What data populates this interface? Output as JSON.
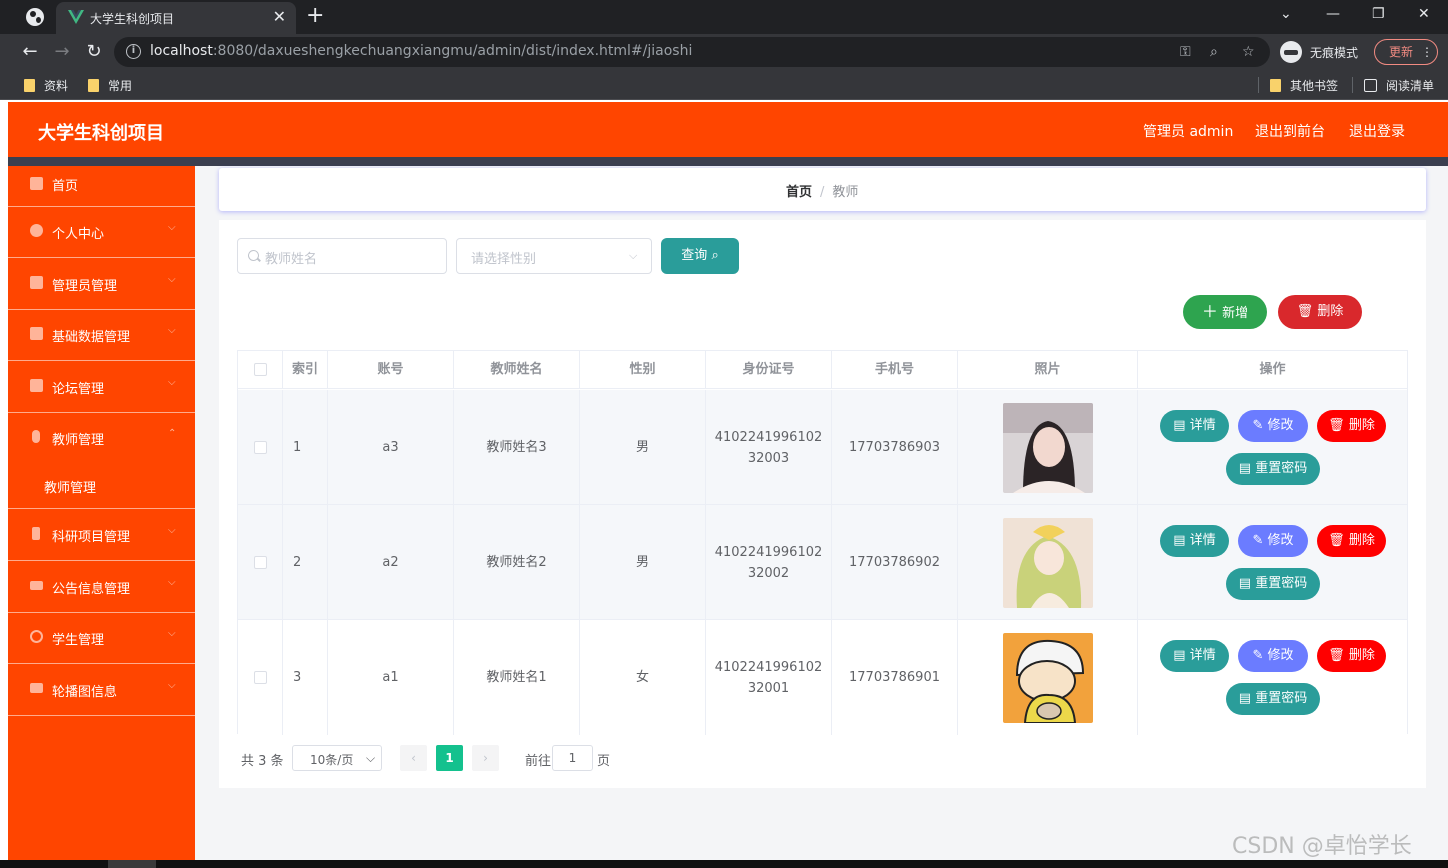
{
  "browser": {
    "tab_title": "大学生科创项目",
    "url_host": "localhost",
    "url_rest": ":8080/daxueshengkechuangxiangmu/admin/dist/index.html#/jiaoshi",
    "incognito_label": "无痕模式",
    "update_label": "更新",
    "bookmarks": [
      "资料",
      "常用"
    ],
    "other_bookmarks": "其他书签",
    "reading_list": "阅读清单"
  },
  "header": {
    "title": "大学生科创项目",
    "admin_label": "管理员 admin",
    "front_label": "退出到前台",
    "logout_label": "退出登录"
  },
  "sidebar": {
    "items": [
      {
        "label": "首页",
        "icon": "home-icon"
      },
      {
        "label": "个人中心",
        "icon": "user-icon"
      },
      {
        "label": "管理员管理",
        "icon": "briefcase-icon"
      },
      {
        "label": "基础数据管理",
        "icon": "chart-icon"
      },
      {
        "label": "论坛管理",
        "icon": "document-icon"
      },
      {
        "label": "教师管理",
        "icon": "microphone-icon",
        "expanded": true
      },
      {
        "label": "科研项目管理",
        "icon": "phone-icon"
      },
      {
        "label": "公告信息管理",
        "icon": "ticket-icon"
      },
      {
        "label": "学生管理",
        "icon": "target-icon"
      },
      {
        "label": "轮播图信息",
        "icon": "monitor-icon"
      }
    ],
    "sub_item": "教师管理"
  },
  "breadcrumb": {
    "home": "首页",
    "current": "教师"
  },
  "search": {
    "name_placeholder": "教师姓名",
    "gender_placeholder": "请选择性别",
    "query_label": "查询"
  },
  "actions": {
    "add_label": "新增",
    "delete_label": "删除"
  },
  "table": {
    "columns": [
      "索引",
      "账号",
      "教师姓名",
      "性别",
      "身份证号",
      "手机号",
      "照片",
      "操作"
    ],
    "rows": [
      {
        "index": "1",
        "account": "a3",
        "name": "教师姓名3",
        "gender": "男",
        "id_card": "410224199610232003",
        "phone": "17703786903"
      },
      {
        "index": "2",
        "account": "a2",
        "name": "教师姓名2",
        "gender": "男",
        "id_card": "410224199610232002",
        "phone": "17703786902"
      },
      {
        "index": "3",
        "account": "a1",
        "name": "教师姓名1",
        "gender": "女",
        "id_card": "410224199610232001",
        "phone": "17703786901"
      }
    ],
    "op_labels": {
      "detail": "详情",
      "edit": "修改",
      "delete": "删除",
      "reset": "重置密码"
    }
  },
  "pagination": {
    "total": "共 3 条",
    "page_size": "10条/页",
    "current_page": "1",
    "goto_label": "前往",
    "goto_value": "1",
    "page_unit": "页"
  },
  "watermark": "CSDN @卓怡学长",
  "colors": {
    "brand": "#ff4500",
    "teal": "#2a9d9a",
    "green": "#2ea44f",
    "red": "#d9282c",
    "edit": "#6b7cff",
    "page_active": "#14c18e"
  }
}
